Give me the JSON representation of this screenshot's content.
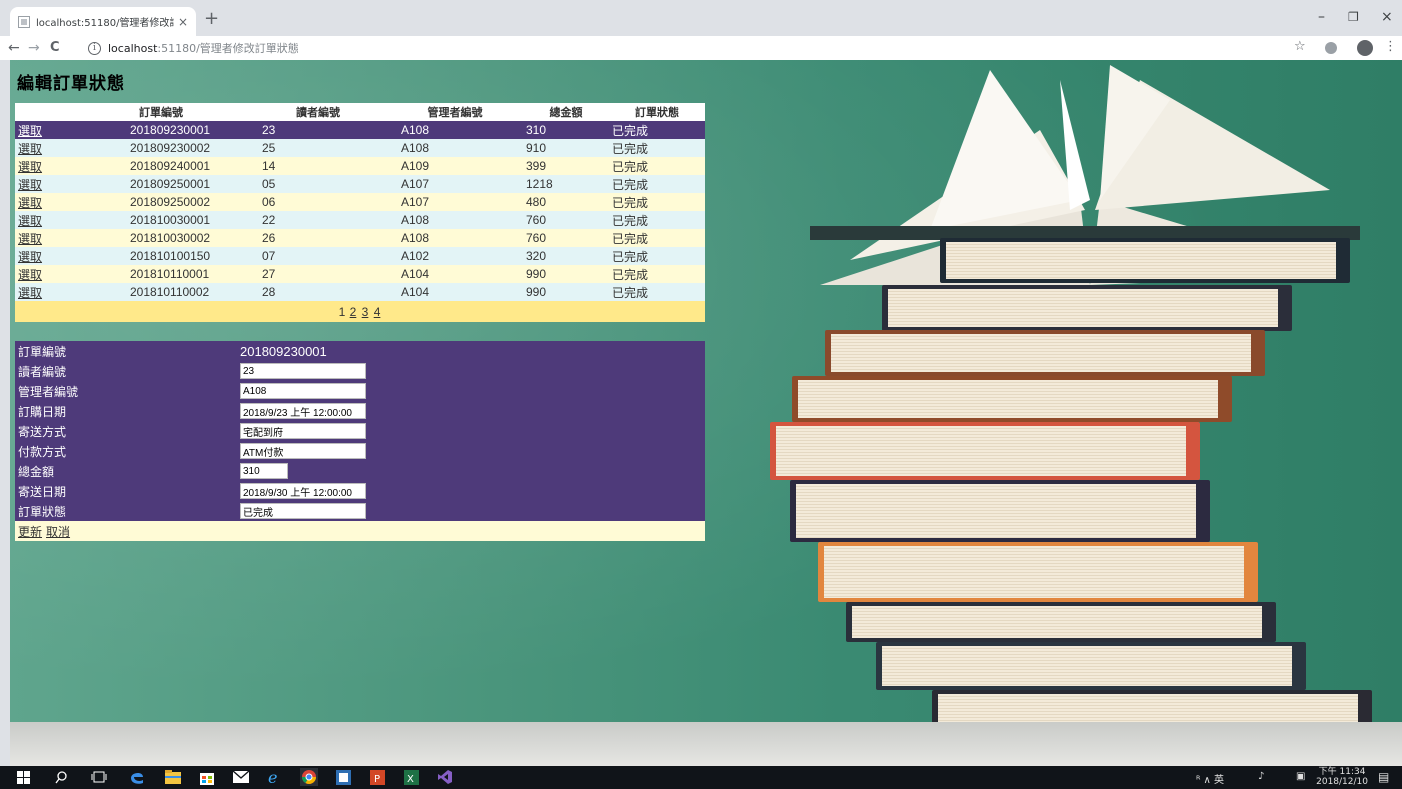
{
  "browser": {
    "tab_title": "localhost:51180/管理者修改訂單",
    "tab_close": "×",
    "new_tab": "+",
    "back": "←",
    "forward": "→",
    "reload": "C",
    "info": "i",
    "url_host": "localhost",
    "url_rest": ":51180/管理者修改訂單狀態",
    "star": "☆",
    "more": "⋮",
    "minimize": "–",
    "restore": "❐",
    "close": "×"
  },
  "page": {
    "title": "編輯訂單狀態"
  },
  "grid": {
    "headers": [
      "",
      "訂單編號",
      "讀者編號",
      "管理者編號",
      "總金額",
      "訂單狀態"
    ],
    "select_label": "選取",
    "rows": [
      {
        "order_id": "201809230001",
        "reader_id": "23",
        "admin_id": "A108",
        "total": "310",
        "status": "已完成"
      },
      {
        "order_id": "201809230002",
        "reader_id": "25",
        "admin_id": "A108",
        "total": "910",
        "status": "已完成"
      },
      {
        "order_id": "201809240001",
        "reader_id": "14",
        "admin_id": "A109",
        "total": "399",
        "status": "已完成"
      },
      {
        "order_id": "201809250001",
        "reader_id": "05",
        "admin_id": "A107",
        "total": "1218",
        "status": "已完成"
      },
      {
        "order_id": "201809250002",
        "reader_id": "06",
        "admin_id": "A107",
        "total": "480",
        "status": "已完成"
      },
      {
        "order_id": "201810030001",
        "reader_id": "22",
        "admin_id": "A108",
        "total": "760",
        "status": "已完成"
      },
      {
        "order_id": "201810030002",
        "reader_id": "26",
        "admin_id": "A108",
        "total": "760",
        "status": "已完成"
      },
      {
        "order_id": "201810100150",
        "reader_id": "07",
        "admin_id": "A102",
        "total": "320",
        "status": "已完成"
      },
      {
        "order_id": "201810110001",
        "reader_id": "27",
        "admin_id": "A104",
        "total": "990",
        "status": "已完成"
      },
      {
        "order_id": "201810110002",
        "reader_id": "28",
        "admin_id": "A104",
        "total": "990",
        "status": "已完成"
      }
    ],
    "pager": [
      "1",
      "2",
      "3",
      "4"
    ]
  },
  "detail": {
    "order_id_label": "訂單編號",
    "order_id": "201809230001",
    "reader_id_label": "讀者編號",
    "reader_id": "23",
    "admin_id_label": "管理者編號",
    "admin_id": "A108",
    "order_date_label": "訂購日期",
    "order_date": "2018/9/23 上午 12:00:00",
    "shipping_label": "寄送方式",
    "shipping": "宅配到府",
    "payment_label": "付款方式",
    "payment": "ATM付款",
    "total_label": "總金額",
    "total": "310",
    "ship_date_label": "寄送日期",
    "ship_date": "2018/9/30 上午 12:00:00",
    "status_label": "訂單狀態",
    "status": "已完成",
    "update_label": "更新",
    "cancel_label": "取消"
  },
  "taskbar": {
    "tray_text": "ᴿ ∧ 英",
    "time": "下午 11:34",
    "date": "2018/12/10"
  }
}
